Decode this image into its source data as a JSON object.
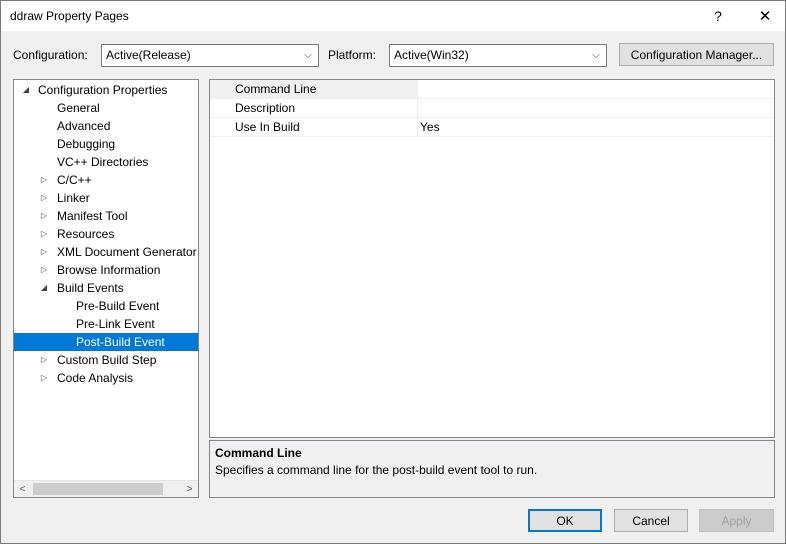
{
  "window": {
    "title": "ddraw Property Pages",
    "help_glyph": "?",
    "close_glyph": "✕"
  },
  "toolbar": {
    "configuration_label": "Configuration:",
    "configuration_value": "Active(Release)",
    "platform_label": "Platform:",
    "platform_value": "Active(Win32)",
    "config_manager_label": "Configuration Manager..."
  },
  "tree": {
    "items": [
      {
        "label": "Configuration Properties",
        "toggle": "◢",
        "level": 0,
        "selected": false
      },
      {
        "label": "General",
        "toggle": "",
        "level": 1,
        "selected": false
      },
      {
        "label": "Advanced",
        "toggle": "",
        "level": 1,
        "selected": false
      },
      {
        "label": "Debugging",
        "toggle": "",
        "level": 1,
        "selected": false
      },
      {
        "label": "VC++ Directories",
        "toggle": "",
        "level": 1,
        "selected": false
      },
      {
        "label": "C/C++",
        "toggle": "▷",
        "level": 1,
        "selected": false
      },
      {
        "label": "Linker",
        "toggle": "▷",
        "level": 1,
        "selected": false
      },
      {
        "label": "Manifest Tool",
        "toggle": "▷",
        "level": 1,
        "selected": false
      },
      {
        "label": "Resources",
        "toggle": "▷",
        "level": 1,
        "selected": false
      },
      {
        "label": "XML Document Generator",
        "toggle": "▷",
        "level": 1,
        "selected": false
      },
      {
        "label": "Browse Information",
        "toggle": "▷",
        "level": 1,
        "selected": false
      },
      {
        "label": "Build Events",
        "toggle": "◢",
        "level": 1,
        "selected": false
      },
      {
        "label": "Pre-Build Event",
        "toggle": "",
        "level": 2,
        "selected": false
      },
      {
        "label": "Pre-Link Event",
        "toggle": "",
        "level": 2,
        "selected": false
      },
      {
        "label": "Post-Build Event",
        "toggle": "",
        "level": 2,
        "selected": true
      },
      {
        "label": "Custom Build Step",
        "toggle": "▷",
        "level": 1,
        "selected": false
      },
      {
        "label": "Code Analysis",
        "toggle": "▷",
        "level": 1,
        "selected": false
      }
    ],
    "scroll_left": "<",
    "scroll_right": ">"
  },
  "grid": {
    "rows": [
      {
        "name": "Command Line",
        "value": "",
        "selected": true
      },
      {
        "name": "Description",
        "value": "",
        "selected": false
      },
      {
        "name": "Use In Build",
        "value": "Yes",
        "selected": false
      }
    ]
  },
  "description": {
    "title": "Command Line",
    "text": "Specifies a command line for the post-build event tool to run."
  },
  "buttons": {
    "ok": "OK",
    "cancel": "Cancel",
    "apply": "Apply"
  },
  "colors": {
    "selection": "#0078d7",
    "window_bg": "#f0f0f0",
    "disabled_text": "#a0a0a0"
  }
}
